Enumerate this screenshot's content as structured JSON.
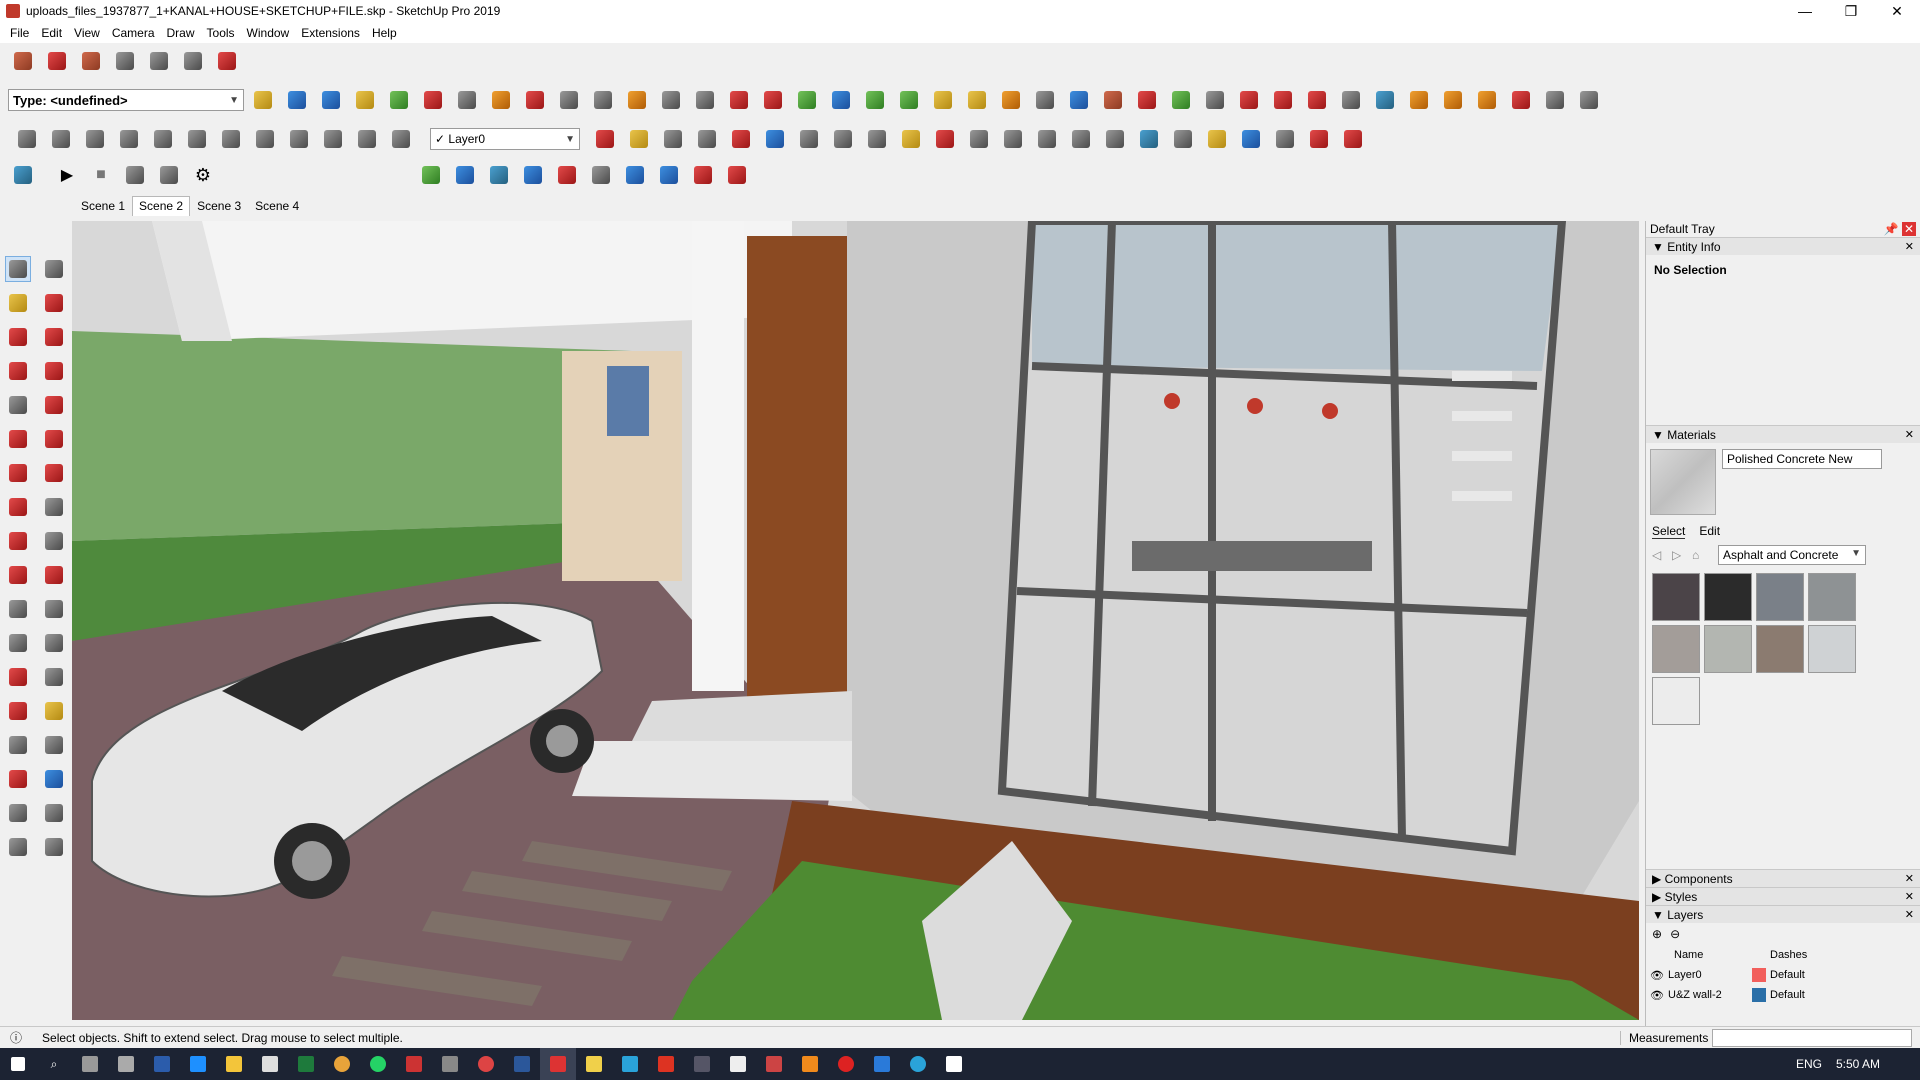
{
  "window": {
    "title": "uploads_files_1937877_1+KANAL+HOUSE+SKETCHUP+FILE.skp - SketchUp Pro 2019",
    "minimize": "—",
    "restore": "❐",
    "close": "✕"
  },
  "menu": [
    "File",
    "Edit",
    "View",
    "Camera",
    "Draw",
    "Tools",
    "Window",
    "Extensions",
    "Help"
  ],
  "toolbar": {
    "type_select": "Type: <undefined>",
    "layer_select": "Layer0",
    "layer_check": "✓"
  },
  "scenes": [
    "Scene 1",
    "Scene 2",
    "Scene 3",
    "Scene 4"
  ],
  "active_scene": "Scene 2",
  "tray": {
    "title": "Default Tray",
    "entity_info": {
      "header": "Entity Info",
      "status": "No Selection"
    },
    "materials": {
      "header": "Materials",
      "current_material": "Polished Concrete New",
      "tab_select": "Select",
      "tab_edit": "Edit",
      "collection": "Asphalt and Concrete",
      "swatch_colors": [
        "#4b4448",
        "#2b2b2b",
        "#7a8088",
        "#8e9294",
        "#a39d99",
        "#b3b6b1",
        "#8b7b70",
        "#cfd2d4",
        "#ececec"
      ]
    },
    "components": "Components",
    "styles": "Styles",
    "layers": {
      "header": "Layers",
      "col_name": "Name",
      "col_dashes": "Dashes",
      "rows": [
        {
          "name": "Layer0",
          "color": "#f25f5c",
          "dashes": "Default"
        },
        {
          "name": "U&Z wall-2",
          "color": "#2a6fa8",
          "dashes": "Default"
        }
      ]
    }
  },
  "status": {
    "message": "Select objects. Shift to extend select. Drag mouse to select multiple.",
    "measurements_label": "Measurements"
  },
  "taskbar": {
    "language": "ENG",
    "time": "5:50 AM"
  },
  "icons": {
    "window_icon": "sketchup-icon",
    "toolbar_icons": "sketchup-tools",
    "palette": [
      "select",
      "component",
      "paint-bucket",
      "eraser",
      "line",
      "freehand",
      "rectangle",
      "rotated-rectangle",
      "circle",
      "polygon",
      "arc",
      "pie",
      "2pt-arc",
      "3pt-arc",
      "move",
      "push-pull",
      "rotate",
      "follow-me",
      "scale",
      "offset",
      "tape-measure",
      "dimension",
      "protractor",
      "text",
      "axes",
      "3d-text",
      "orbit",
      "pan",
      "zoom",
      "zoom-window",
      "zoom-extents",
      "previous",
      "position-camera",
      "look-around",
      "walk",
      "section-plane"
    ]
  }
}
